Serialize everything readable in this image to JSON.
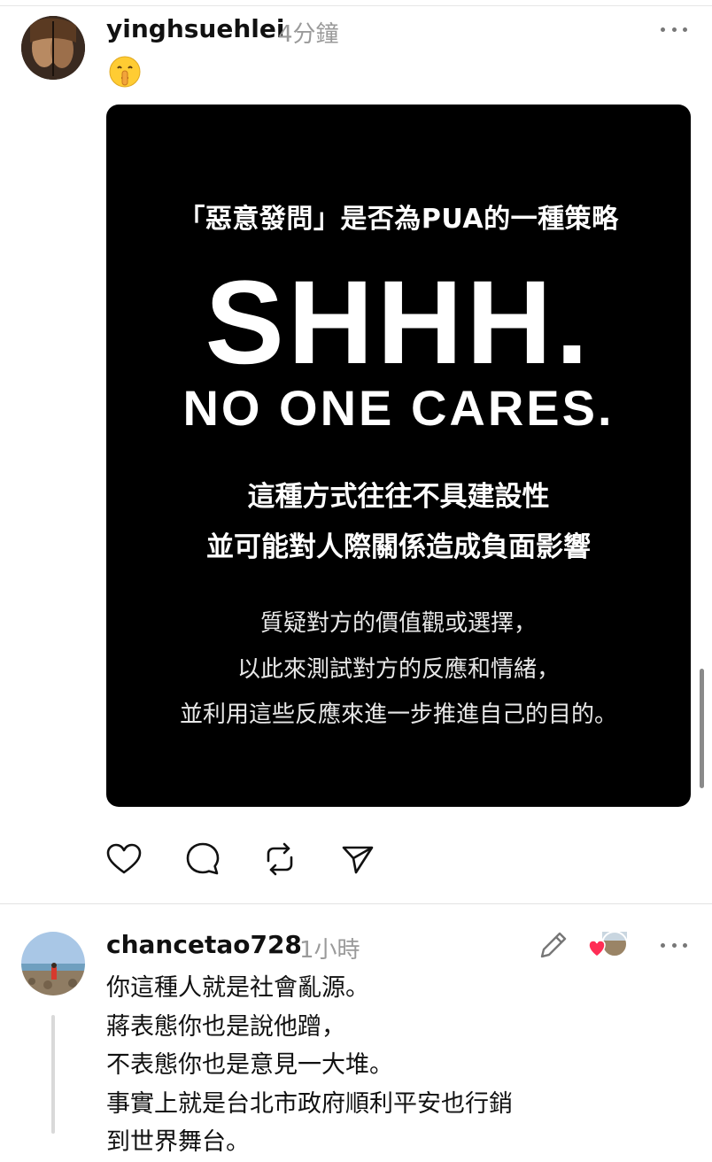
{
  "post": {
    "username": "yinghsuehlei",
    "time": "4分鐘",
    "emoji": "🤫",
    "image": {
      "top_line": "「惡意發問」是否為PUA的一種策略",
      "headline": "SHHH.",
      "subheadline": "NO ONE CARES.",
      "bold_line_1": "這種方式往往不具建設性",
      "bold_line_2": "並可能對人際關係造成負面影響",
      "small_line_1": "質疑對方的價值觀或選擇，",
      "small_line_2": "以此來測試對方的反應和情緒，",
      "small_line_3": "並利用這些反應來進一步推進自己的目的。"
    },
    "actions": [
      "heart-icon",
      "comment-icon",
      "repost-icon",
      "share-icon"
    ]
  },
  "reply": {
    "username": "chancetao728",
    "time": "1小時",
    "lines": [
      "你這種人就是社會亂源。",
      "蔣表態你也是說他蹭，",
      "不表態你也是意見一大堆。",
      "事實上就是台北市政府順利平安也行銷",
      "到世界舞台。"
    ]
  },
  "colors": {
    "muted_text": "#9a9a9a",
    "image_bg": "#000000",
    "like_heart": "#ff2d55"
  }
}
